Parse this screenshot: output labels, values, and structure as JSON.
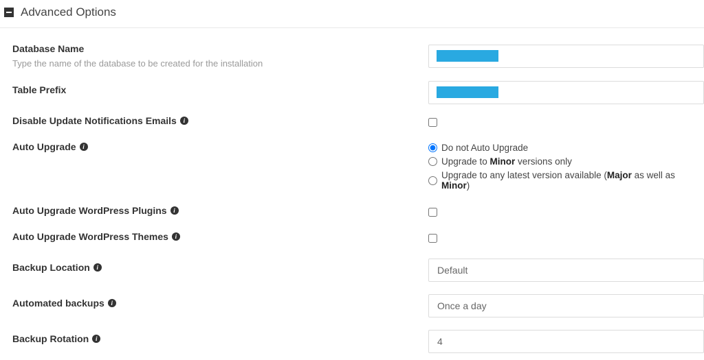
{
  "section": {
    "title": "Advanced Options"
  },
  "fields": {
    "databaseName": {
      "label": "Database Name",
      "help": "Type the name of the database to be created for the installation",
      "value": ""
    },
    "tablePrefix": {
      "label": "Table Prefix",
      "value": ""
    },
    "disableUpdateEmails": {
      "label": "Disable Update Notifications Emails"
    },
    "autoUpgrade": {
      "label": "Auto Upgrade",
      "options": {
        "none": "Do not Auto Upgrade",
        "minor_prefix": "Upgrade to ",
        "minor_bold": "Minor",
        "minor_suffix": " versions only",
        "any_prefix": "Upgrade to any latest version available (",
        "any_bold1": "Major",
        "any_mid": " as well as ",
        "any_bold2": "Minor",
        "any_suffix": ")"
      }
    },
    "autoUpgradePlugins": {
      "label": "Auto Upgrade WordPress Plugins"
    },
    "autoUpgradeThemes": {
      "label": "Auto Upgrade WordPress Themes"
    },
    "backupLocation": {
      "label": "Backup Location",
      "value": "Default"
    },
    "automatedBackups": {
      "label": "Automated backups",
      "value": "Once a day"
    },
    "backupRotation": {
      "label": "Backup Rotation",
      "value": "4"
    }
  }
}
